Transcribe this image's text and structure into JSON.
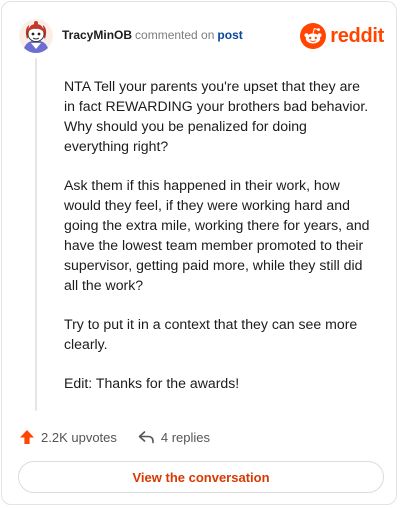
{
  "header": {
    "username": "TracyMinOB",
    "action": "commented on",
    "link_label": "post",
    "brand": "reddit"
  },
  "comment": {
    "paragraphs": [
      "NTA Tell your parents you're upset that they are in fact REWARDING your brothers bad behavior. Why should you be penalized for doing everything right?",
      "Ask them if this happened in their work, how would they feel, if they were working hard and going the extra mile, working there for years, and have the lowest team member promoted to their supervisor, getting paid more, while they still did all the work?",
      "Try to put it in a context that they can see more clearly.",
      "Edit: Thanks for the awards!"
    ]
  },
  "footer": {
    "upvotes": "2.2K upvotes",
    "replies": "4 replies",
    "cta": "View the conversation"
  },
  "colors": {
    "brand": "#ff4500",
    "link": "#0a449b",
    "cta": "#d93900"
  }
}
